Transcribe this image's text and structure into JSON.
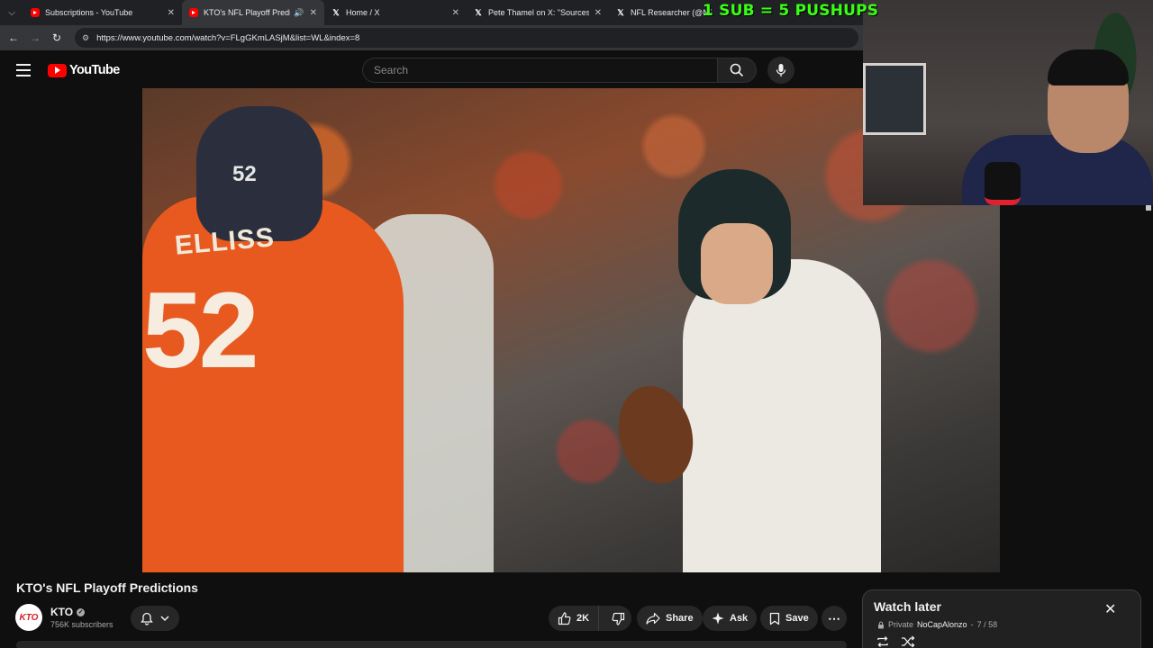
{
  "browser": {
    "tabs": [
      {
        "label": "Subscriptions - YouTube",
        "favicon": "youtube-favicon",
        "active": false
      },
      {
        "label": "KTO's NFL Playoff Predictio",
        "favicon": "youtube-favicon",
        "active": true
      },
      {
        "label": "Home / X",
        "favicon": "x-favicon",
        "active": false
      },
      {
        "label": "Pete Thamel on X: \"Sources: O",
        "favicon": "x-favicon",
        "active": false
      },
      {
        "label": "NFL Researcher (@NFL_Resea",
        "favicon": "x-favicon",
        "active": false
      }
    ],
    "url": "https://www.youtube.com/watch?v=FLgGKmLASjM&list=WL&index=8"
  },
  "overlay": {
    "stream_text": "1 SUB = 5 PUSHUPS",
    "color": "#39ff14"
  },
  "youtube": {
    "logo_text": "YouTube",
    "search_placeholder": "Search",
    "video": {
      "jersey_name": "ELLISS",
      "jersey_number": "52",
      "helmet_number": "52"
    },
    "title": "KTO's NFL Playoff Predictions",
    "channel": {
      "name": "KTO",
      "avatar_text": "KTO",
      "subscribers": "756K subscribers"
    },
    "actions": {
      "likes": "2K",
      "share": "Share",
      "ask": "Ask",
      "save": "Save"
    },
    "watch_later": {
      "title": "Watch later",
      "privacy": "Private",
      "owner": "NoCapAlonzo",
      "position": "7 / 58"
    }
  },
  "colors": {
    "brand_red": "#ff0000",
    "background": "#0f0f0f",
    "chip": "#272727"
  }
}
